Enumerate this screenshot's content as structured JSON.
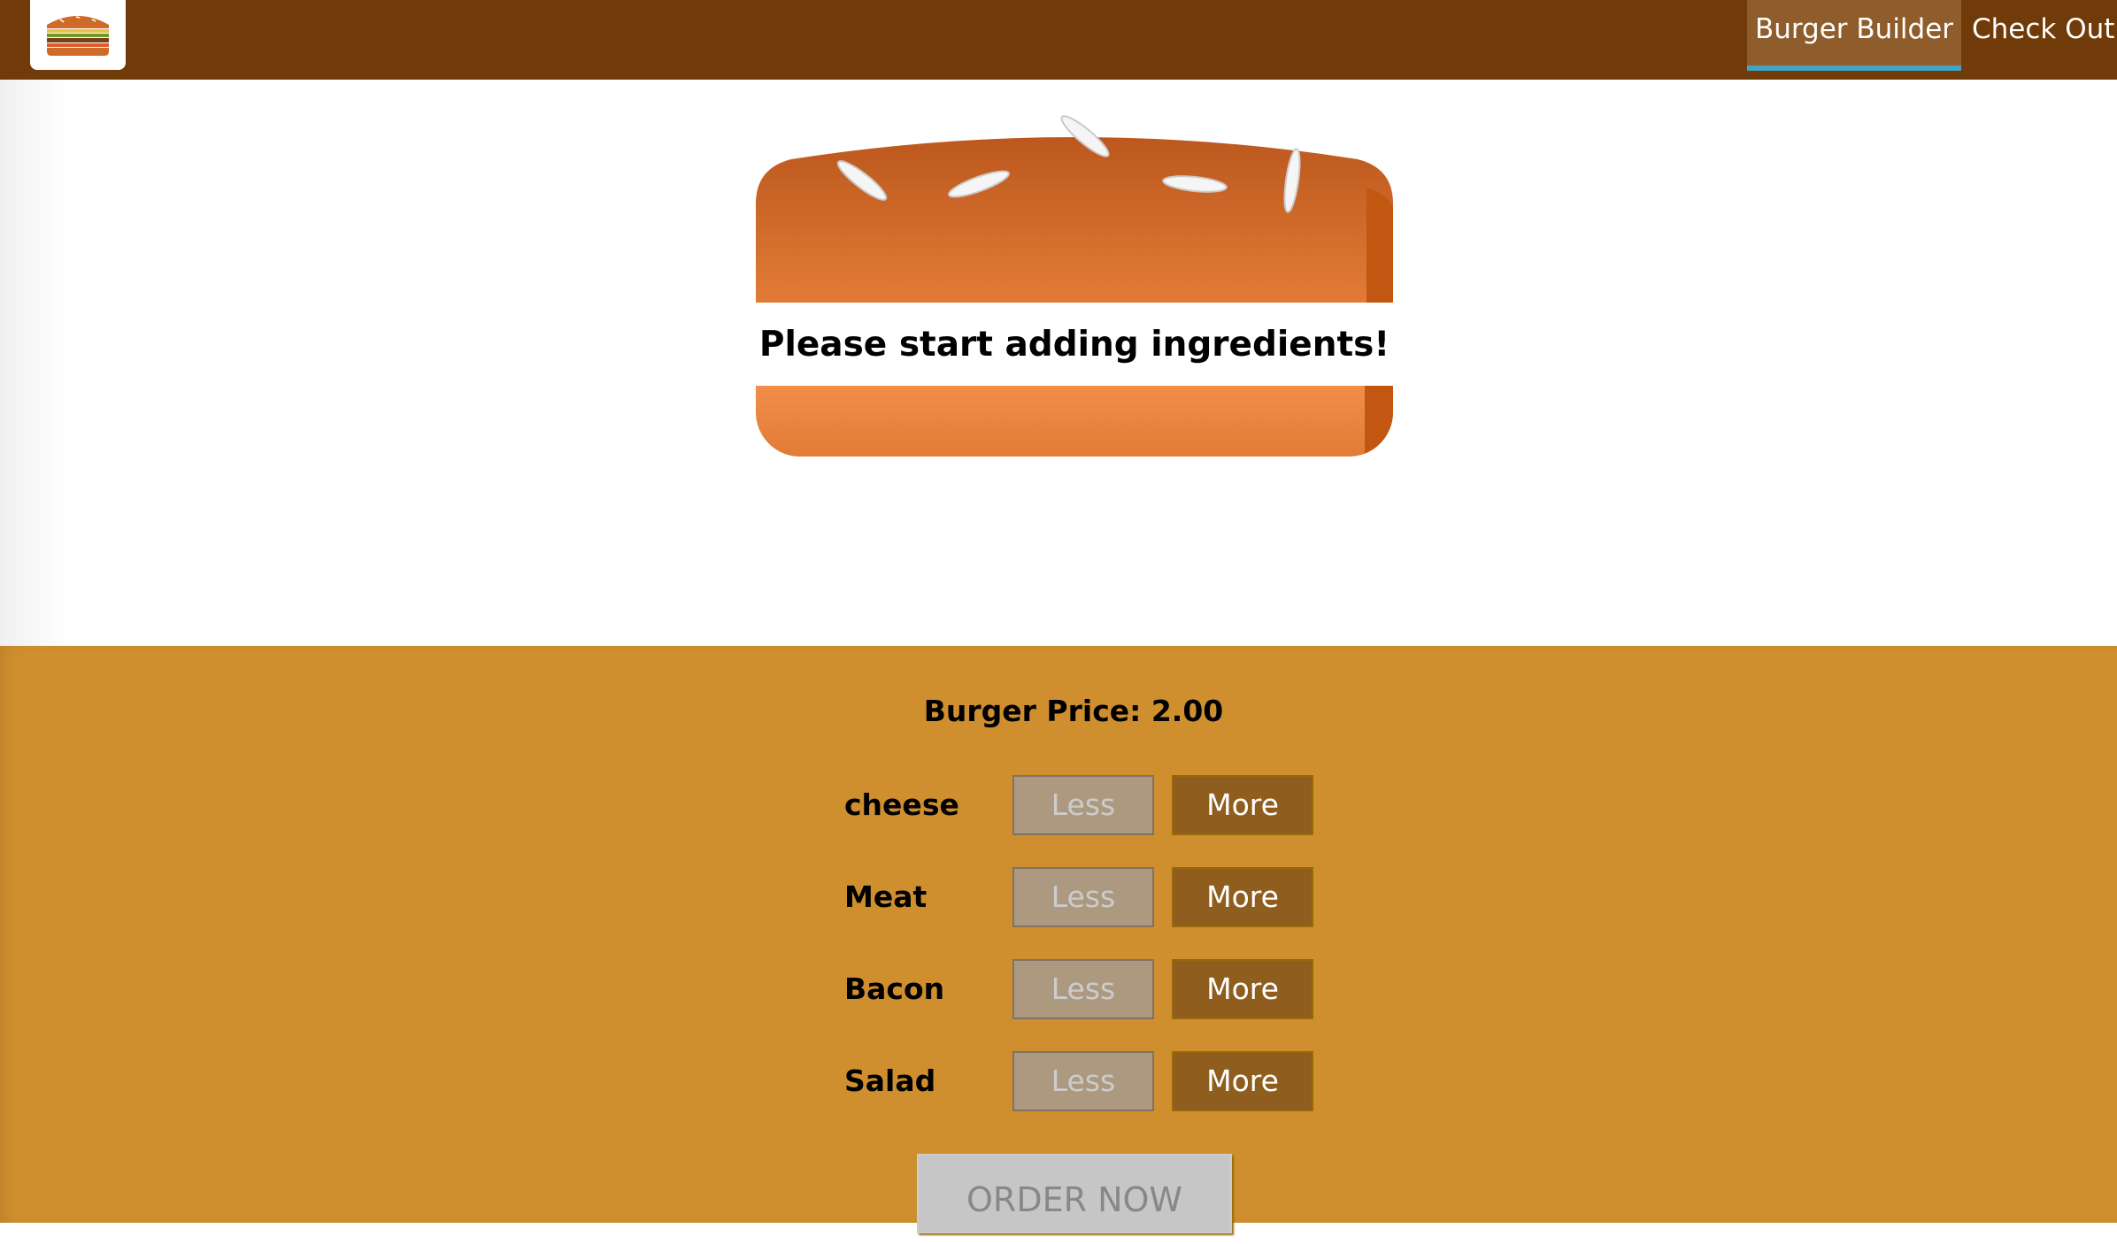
{
  "toolbar": {
    "logo_icon": "burger-logo-icon",
    "nav": [
      {
        "label": "Burger Builder",
        "active": true
      },
      {
        "label": "Check Out",
        "active": false
      }
    ],
    "colors": {
      "background": "#703b09",
      "active_item": "#8f5c2c",
      "active_underline": "#40a4c8"
    }
  },
  "burger": {
    "message": "Please start adding ingredients!"
  },
  "controls": {
    "price_label": "Burger Price: 2.00",
    "rows": [
      {
        "label": "cheese",
        "less": "Less",
        "more": "More",
        "less_disabled": true
      },
      {
        "label": "Meat",
        "less": "Less",
        "more": "More",
        "less_disabled": true
      },
      {
        "label": "Bacon",
        "less": "Less",
        "more": "More",
        "less_disabled": true
      },
      {
        "label": "Salad",
        "less": "Less",
        "more": "More",
        "less_disabled": true
      }
    ],
    "order_button": "ORDER NOW",
    "order_disabled": true,
    "colors": {
      "background": "#cf8f2e",
      "more_button": "#8f5e1e",
      "less_button": "#ac9980"
    }
  }
}
